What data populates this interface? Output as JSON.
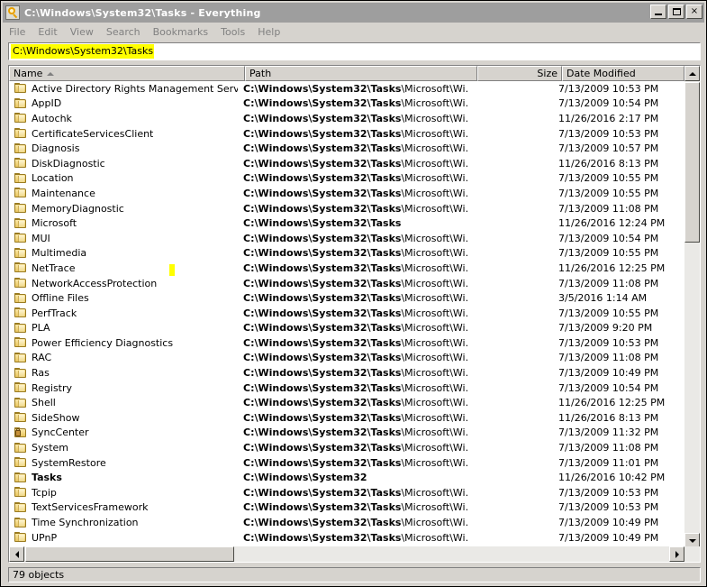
{
  "window": {
    "title": "C:\\Windows\\System32\\Tasks - Everything",
    "icon": "everything-magnifier-icon",
    "minimize_label": "",
    "maximize_label": "",
    "close_label": "×"
  },
  "menubar": {
    "items": [
      {
        "label": "File"
      },
      {
        "label": "Edit"
      },
      {
        "label": "View"
      },
      {
        "label": "Search"
      },
      {
        "label": "Bookmarks"
      },
      {
        "label": "Tools"
      },
      {
        "label": "Help"
      }
    ]
  },
  "search": {
    "value": "C:\\Windows\\System32\\Tasks",
    "placeholder": "",
    "selected": true,
    "highlight_color": "#ffff00"
  },
  "columns": [
    {
      "key": "name",
      "label": "Name",
      "sorted": "asc",
      "align": "left"
    },
    {
      "key": "path",
      "label": "Path",
      "sorted": "",
      "align": "left"
    },
    {
      "key": "size",
      "label": "Size",
      "sorted": "",
      "align": "right"
    },
    {
      "key": "date",
      "label": "Date Modified",
      "sorted": "",
      "align": "left"
    }
  ],
  "match_prefix": "C:\\Windows\\System32\\Tasks",
  "rows": [
    {
      "name": "Active Directory Rights Management Services...",
      "icon": "folder-icon",
      "bold_name": false,
      "path_match": "C:\\Windows\\System32\\Tasks",
      "path_rest": "\\Microsoft\\Wi...",
      "size": "",
      "date": "7/13/2009 10:53 PM"
    },
    {
      "name": "AppID",
      "icon": "folder-icon",
      "bold_name": false,
      "path_match": "C:\\Windows\\System32\\Tasks",
      "path_rest": "\\Microsoft\\Wi...",
      "size": "",
      "date": "7/13/2009 10:54 PM"
    },
    {
      "name": "Autochk",
      "icon": "folder-icon",
      "bold_name": false,
      "path_match": "C:\\Windows\\System32\\Tasks",
      "path_rest": "\\Microsoft\\Wi...",
      "size": "",
      "date": "11/26/2016 2:17 PM"
    },
    {
      "name": "CertificateServicesClient",
      "icon": "folder-icon",
      "bold_name": false,
      "path_match": "C:\\Windows\\System32\\Tasks",
      "path_rest": "\\Microsoft\\Wi...",
      "size": "",
      "date": "7/13/2009 10:53 PM"
    },
    {
      "name": "Diagnosis",
      "icon": "folder-icon",
      "bold_name": false,
      "path_match": "C:\\Windows\\System32\\Tasks",
      "path_rest": "\\Microsoft\\Wi...",
      "size": "",
      "date": "7/13/2009 10:57 PM"
    },
    {
      "name": "DiskDiagnostic",
      "icon": "folder-icon",
      "bold_name": false,
      "path_match": "C:\\Windows\\System32\\Tasks",
      "path_rest": "\\Microsoft\\Wi...",
      "size": "",
      "date": "11/26/2016 8:13 PM"
    },
    {
      "name": "Location",
      "icon": "folder-icon",
      "bold_name": false,
      "path_match": "C:\\Windows\\System32\\Tasks",
      "path_rest": "\\Microsoft\\Wi...",
      "size": "",
      "date": "7/13/2009 10:55 PM"
    },
    {
      "name": "Maintenance",
      "icon": "folder-icon",
      "bold_name": false,
      "path_match": "C:\\Windows\\System32\\Tasks",
      "path_rest": "\\Microsoft\\Wi...",
      "size": "",
      "date": "7/13/2009 10:55 PM"
    },
    {
      "name": "MemoryDiagnostic",
      "icon": "folder-icon",
      "bold_name": false,
      "path_match": "C:\\Windows\\System32\\Tasks",
      "path_rest": "\\Microsoft\\Wi...",
      "size": "",
      "date": "7/13/2009 11:08 PM"
    },
    {
      "name": "Microsoft",
      "icon": "folder-icon",
      "bold_name": false,
      "path_match": "C:\\Windows\\System32\\Tasks",
      "path_rest": "",
      "size": "",
      "date": "11/26/2016 12:24 PM"
    },
    {
      "name": "MUI",
      "icon": "folder-icon",
      "bold_name": false,
      "path_match": "C:\\Windows\\System32\\Tasks",
      "path_rest": "\\Microsoft\\Wi...",
      "size": "",
      "date": "7/13/2009 10:54 PM"
    },
    {
      "name": "Multimedia",
      "icon": "folder-icon",
      "bold_name": false,
      "path_match": "C:\\Windows\\System32\\Tasks",
      "path_rest": "\\Microsoft\\Wi...",
      "size": "",
      "date": "7/13/2009 10:55 PM"
    },
    {
      "name": "NetTrace",
      "icon": "folder-icon",
      "bold_name": false,
      "path_match": "C:\\Windows\\System32\\Tasks",
      "path_rest": "\\Microsoft\\Wi...",
      "size": "",
      "date": "11/26/2016 12:25 PM"
    },
    {
      "name": "NetworkAccessProtection",
      "icon": "folder-icon",
      "bold_name": false,
      "path_match": "C:\\Windows\\System32\\Tasks",
      "path_rest": "\\Microsoft\\Wi...",
      "size": "",
      "date": "7/13/2009 11:08 PM"
    },
    {
      "name": "Offline Files",
      "icon": "folder-icon",
      "bold_name": false,
      "path_match": "C:\\Windows\\System32\\Tasks",
      "path_rest": "\\Microsoft\\Wi...",
      "size": "",
      "date": "3/5/2016 1:14 AM"
    },
    {
      "name": "PerfTrack",
      "icon": "folder-icon",
      "bold_name": false,
      "path_match": "C:\\Windows\\System32\\Tasks",
      "path_rest": "\\Microsoft\\Wi...",
      "size": "",
      "date": "7/13/2009 10:55 PM"
    },
    {
      "name": "PLA",
      "icon": "folder-icon",
      "bold_name": false,
      "path_match": "C:\\Windows\\System32\\Tasks",
      "path_rest": "\\Microsoft\\Wi...",
      "size": "",
      "date": "7/13/2009 9:20 PM"
    },
    {
      "name": "Power Efficiency Diagnostics",
      "icon": "folder-icon",
      "bold_name": false,
      "path_match": "C:\\Windows\\System32\\Tasks",
      "path_rest": "\\Microsoft\\Wi...",
      "size": "",
      "date": "7/13/2009 10:53 PM"
    },
    {
      "name": "RAC",
      "icon": "folder-icon",
      "bold_name": false,
      "path_match": "C:\\Windows\\System32\\Tasks",
      "path_rest": "\\Microsoft\\Wi...",
      "size": "",
      "date": "7/13/2009 11:08 PM"
    },
    {
      "name": "Ras",
      "icon": "folder-icon",
      "bold_name": false,
      "path_match": "C:\\Windows\\System32\\Tasks",
      "path_rest": "\\Microsoft\\Wi...",
      "size": "",
      "date": "7/13/2009 10:49 PM"
    },
    {
      "name": "Registry",
      "icon": "folder-icon",
      "bold_name": false,
      "path_match": "C:\\Windows\\System32\\Tasks",
      "path_rest": "\\Microsoft\\Wi...",
      "size": "",
      "date": "7/13/2009 10:54 PM"
    },
    {
      "name": "Shell",
      "icon": "folder-icon",
      "bold_name": false,
      "path_match": "C:\\Windows\\System32\\Tasks",
      "path_rest": "\\Microsoft\\Wi...",
      "size": "",
      "date": "11/26/2016 12:25 PM"
    },
    {
      "name": "SideShow",
      "icon": "folder-icon",
      "bold_name": false,
      "path_match": "C:\\Windows\\System32\\Tasks",
      "path_rest": "\\Microsoft\\Wi...",
      "size": "",
      "date": "11/26/2016 8:13 PM"
    },
    {
      "name": "SyncCenter",
      "icon": "folder-locked-icon",
      "bold_name": false,
      "path_match": "C:\\Windows\\System32\\Tasks",
      "path_rest": "\\Microsoft\\Wi...",
      "size": "",
      "date": "7/13/2009 11:32 PM"
    },
    {
      "name": "System",
      "icon": "folder-icon",
      "bold_name": false,
      "path_match": "C:\\Windows\\System32\\Tasks",
      "path_rest": "\\Microsoft\\Wi...",
      "size": "",
      "date": "7/13/2009 11:08 PM"
    },
    {
      "name": "SystemRestore",
      "icon": "folder-icon",
      "bold_name": false,
      "path_match": "C:\\Windows\\System32\\Tasks",
      "path_rest": "\\Microsoft\\Wi...",
      "size": "",
      "date": "7/13/2009 11:01 PM"
    },
    {
      "name": "Tasks",
      "icon": "folder-icon",
      "bold_name": true,
      "path_match": "C:\\Windows\\System32",
      "path_rest": "",
      "size": "",
      "date": "11/26/2016 10:42 PM"
    },
    {
      "name": "Tcpip",
      "icon": "folder-icon",
      "bold_name": false,
      "path_match": "C:\\Windows\\System32\\Tasks",
      "path_rest": "\\Microsoft\\Wi...",
      "size": "",
      "date": "7/13/2009 10:53 PM"
    },
    {
      "name": "TextServicesFramework",
      "icon": "folder-icon",
      "bold_name": false,
      "path_match": "C:\\Windows\\System32\\Tasks",
      "path_rest": "\\Microsoft\\Wi...",
      "size": "",
      "date": "7/13/2009 10:53 PM"
    },
    {
      "name": "Time Synchronization",
      "icon": "folder-icon",
      "bold_name": false,
      "path_match": "C:\\Windows\\System32\\Tasks",
      "path_rest": "\\Microsoft\\Wi...",
      "size": "",
      "date": "7/13/2009 10:49 PM"
    },
    {
      "name": "UPnP",
      "icon": "folder-icon",
      "bold_name": false,
      "path_match": "C:\\Windows\\System32\\Tasks",
      "path_rest": "\\Microsoft\\Wi...",
      "size": "",
      "date": "7/13/2009 10:49 PM"
    }
  ],
  "statusbar": {
    "text": "79 objects"
  }
}
